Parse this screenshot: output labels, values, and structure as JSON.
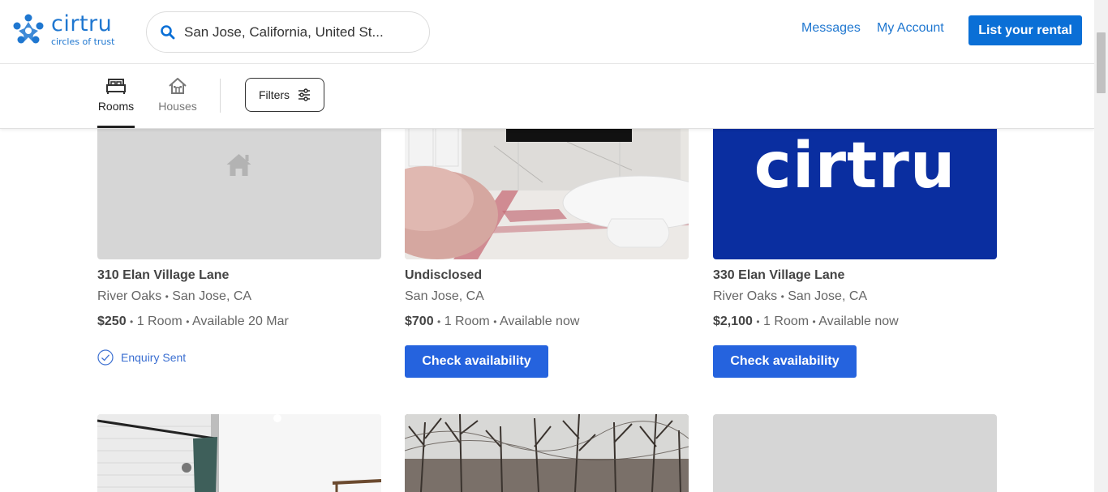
{
  "header": {
    "logo_word": "cirtru",
    "logo_tagline": "circles of trust",
    "search_value": "San Jose, California, United St...",
    "messages": "Messages",
    "my_account": "My Account",
    "list_rental": "List your rental"
  },
  "subbar": {
    "tabs": [
      {
        "label": "Rooms",
        "active": true
      },
      {
        "label": "Houses",
        "active": false
      }
    ],
    "filters": "Filters"
  },
  "listings": [
    {
      "title": "310 Elan Village Lane",
      "neighborhood": "River Oaks",
      "city": "San Jose, CA",
      "price": "$250",
      "rooms": "1 Room",
      "availability": "Available 20 Mar",
      "status": "Enquiry Sent",
      "photo": "placeholder-house-icon"
    },
    {
      "title": "Undisclosed",
      "neighborhood": "",
      "city": "San Jose, CA",
      "price": "$700",
      "rooms": "1 Room",
      "availability": "Available now",
      "action": "Check availability",
      "photo": "living-room"
    },
    {
      "title": "330 Elan Village Lane",
      "neighborhood": "River Oaks",
      "city": "San Jose, CA",
      "price": "$2,100",
      "rooms": "1 Room",
      "availability": "Available now",
      "action": "Check availability",
      "photo": "cirtru-logo",
      "photo_text": "cirtru"
    },
    {
      "photo": "bathroom"
    },
    {
      "photo": "bare-trees"
    },
    {
      "photo": "placeholder-gray"
    }
  ],
  "separator": "•",
  "colors": {
    "brand": "#1f77d0",
    "primary_button": "#2563de",
    "logo_tile": "#0a2ea0"
  }
}
